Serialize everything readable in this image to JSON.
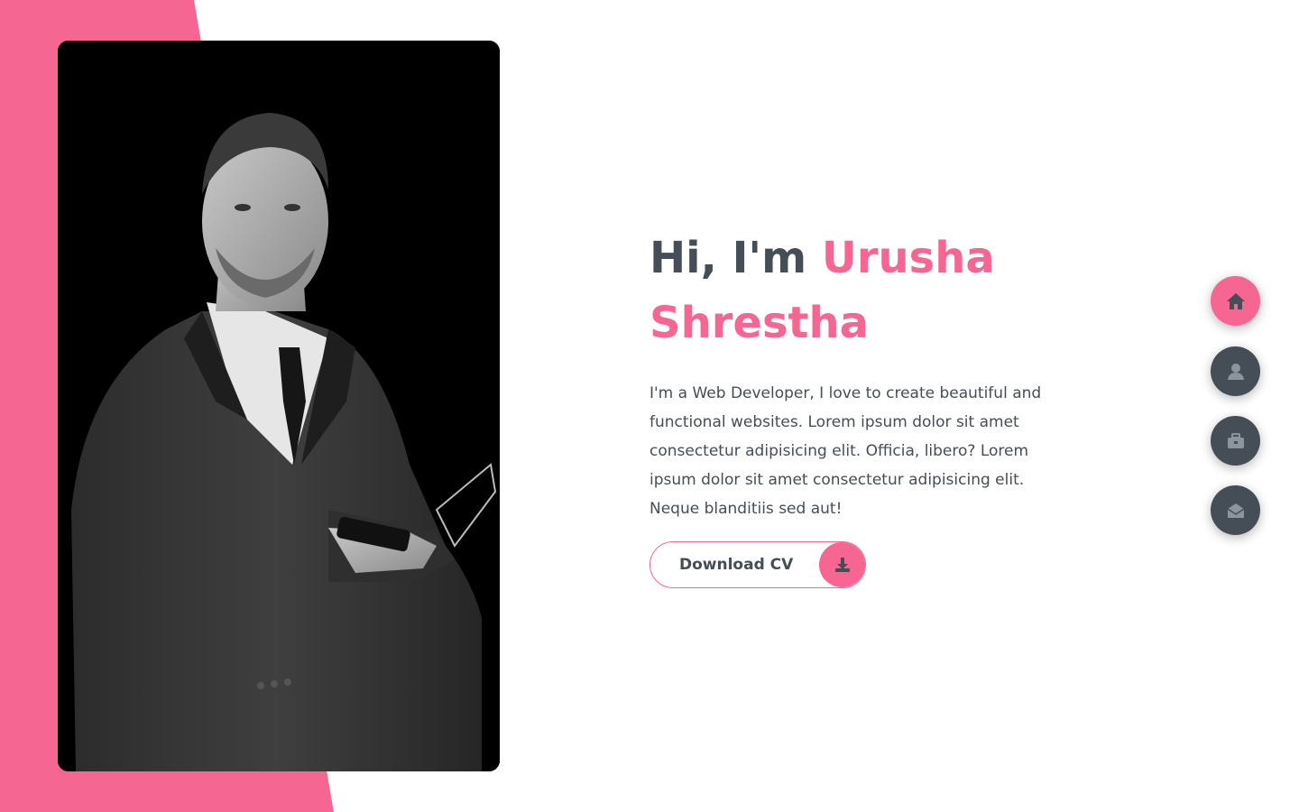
{
  "theme": {
    "accent": "#f56692",
    "dark": "#454e56",
    "background": "#ffffff",
    "photo_background": "#000000"
  },
  "hero": {
    "greeting": "Hi, I'm",
    "name": "Urusha Shrestha",
    "description": "I'm a Web Developer, I love to create beautiful and functional websites. Lorem ipsum dolor sit amet consectetur adipisicing elit. Officia, libero? Lorem ipsum dolor sit amet consectetur adipisicing elit. Neque blanditiis sed aut!",
    "portrait": "black-and-white portrait photo of a man in a suit holding a phone"
  },
  "cv_button": {
    "label": "Download CV",
    "icon": "download-icon"
  },
  "side_nav": {
    "items": [
      {
        "icon": "home-icon",
        "active": true
      },
      {
        "icon": "user-icon",
        "active": false
      },
      {
        "icon": "briefcase-icon",
        "active": false
      },
      {
        "icon": "envelope-open-icon",
        "active": false
      }
    ]
  }
}
